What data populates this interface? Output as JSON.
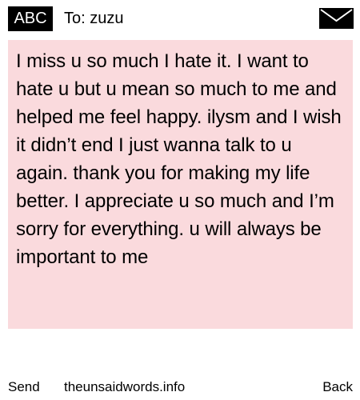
{
  "header": {
    "mode_label": "ABC",
    "recipient": "To: zuzu",
    "envelope_icon": "envelope-icon"
  },
  "message": {
    "body": "I miss u so much I hate it. I want to hate u but u mean so much to me and helped me feel happy. ilysm and I wish it didn’t end I just wanna talk to u again. thank you for making my life better. I appreciate u so much and I’m sorry for everything. u will always be important to me"
  },
  "footer": {
    "send_label": "Send",
    "site": "theunsaidwords.info",
    "back_label": "Back"
  },
  "colors": {
    "message_background": "#fadadd",
    "badge_background": "#000000",
    "badge_text": "#ffffff",
    "text": "#000000"
  }
}
